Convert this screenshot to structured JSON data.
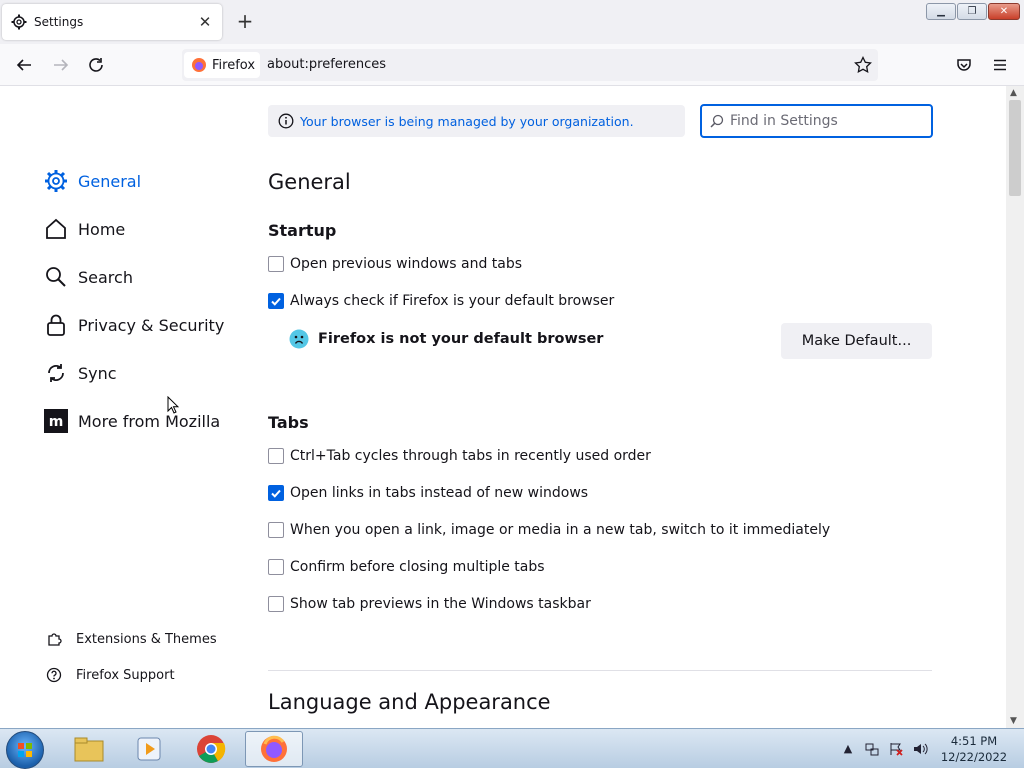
{
  "tab": {
    "title": "Settings",
    "close": "✕",
    "new_tab": "+"
  },
  "window_controls": {
    "minimize": "▁",
    "maximize": "❐",
    "close": "✕"
  },
  "navbar": {
    "identity_label": "Firefox",
    "url": "about:preferences"
  },
  "managed_notice": "Your browser is being managed by your organization.",
  "search": {
    "placeholder": "Find in Settings"
  },
  "sidebar": {
    "items": [
      {
        "label": "General",
        "icon": "gear-icon",
        "active": true
      },
      {
        "label": "Home",
        "icon": "home-icon"
      },
      {
        "label": "Search",
        "icon": "search-icon"
      },
      {
        "label": "Privacy & Security",
        "icon": "lock-icon"
      },
      {
        "label": "Sync",
        "icon": "sync-icon"
      },
      {
        "label": "More from Mozilla",
        "icon": "mozilla-icon"
      }
    ],
    "footer": [
      {
        "label": "Extensions & Themes",
        "icon": "puzzle-icon"
      },
      {
        "label": "Firefox Support",
        "icon": "help-icon"
      }
    ]
  },
  "main": {
    "title": "General",
    "startup": {
      "heading": "Startup",
      "options": [
        {
          "label": "Open previous windows and tabs",
          "checked": false
        },
        {
          "label": "Always check if Firefox is your default browser",
          "checked": true
        }
      ],
      "not_default_text": "Firefox is not your default browser",
      "make_default_button": "Make Default..."
    },
    "tabs": {
      "heading": "Tabs",
      "options": [
        {
          "label": "Ctrl+Tab cycles through tabs in recently used order",
          "checked": false
        },
        {
          "label": "Open links in tabs instead of new windows",
          "checked": true
        },
        {
          "label": "When you open a link, image or media in a new tab, switch to it immediately",
          "checked": false
        },
        {
          "label": "Confirm before closing multiple tabs",
          "checked": false
        },
        {
          "label": "Show tab previews in the Windows taskbar",
          "checked": false
        }
      ]
    },
    "next_section": "Language and Appearance"
  },
  "taskbar": {
    "apps": [
      "windows-explorer-icon",
      "media-player-icon",
      "chrome-icon",
      "firefox-icon"
    ],
    "clock_time": "4:51 PM",
    "clock_date": "12/22/2022"
  },
  "colors": {
    "accent": "#0061e0",
    "link": "#0060df",
    "background": "#f0f0f4"
  }
}
